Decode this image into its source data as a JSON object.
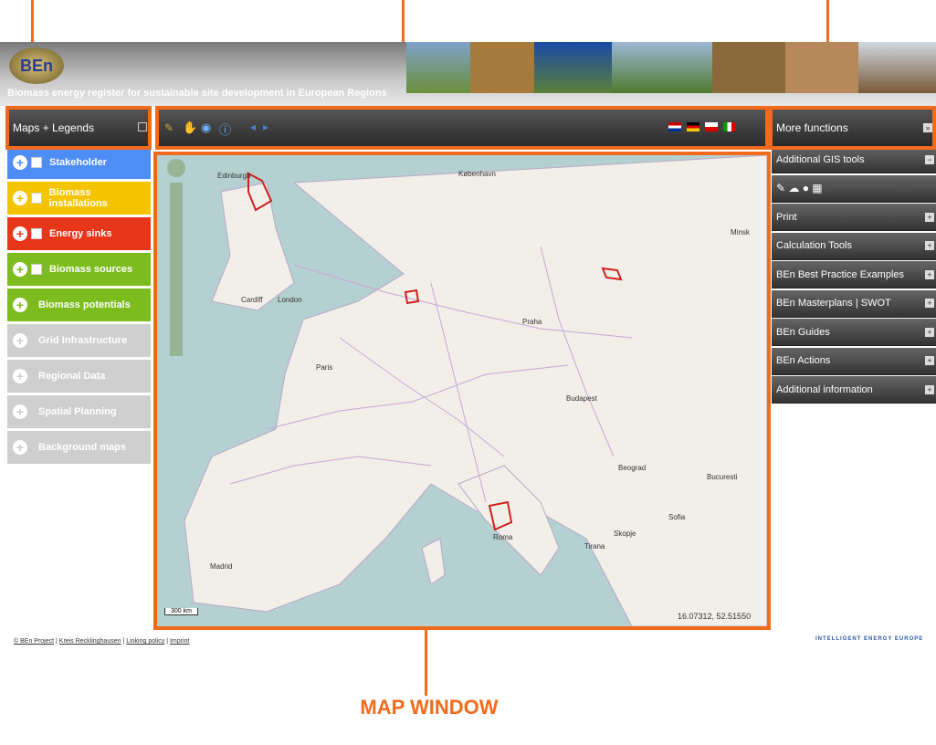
{
  "header": {
    "logo_text": "BEn",
    "tagline": "Biomass energy register for sustainable site development in European Regions"
  },
  "left_panel": {
    "title": "Maps + Legends",
    "layers": [
      {
        "label": "Stakeholder",
        "color": "#4d8df5",
        "checkbox": true,
        "active": true
      },
      {
        "label": "Biomass installations",
        "color": "#f5c400",
        "checkbox": true,
        "active": true
      },
      {
        "label": "Energy sinks",
        "color": "#e8361b",
        "checkbox": true,
        "active": true
      },
      {
        "label": "Biomass sources",
        "color": "#7cbc1e",
        "checkbox": true,
        "active": true
      },
      {
        "label": "Biomass potentials",
        "color": "#7cbc1e",
        "checkbox": false,
        "active": true
      },
      {
        "label": "Grid Infrastructure",
        "color": "#cfcfcf",
        "checkbox": false,
        "active": false
      },
      {
        "label": "Regional Data",
        "color": "#cfcfcf",
        "checkbox": false,
        "active": false
      },
      {
        "label": "Spatial Planning",
        "color": "#cfcfcf",
        "checkbox": false,
        "active": false
      },
      {
        "label": "Background maps",
        "color": "#cfcfcf",
        "checkbox": false,
        "active": false
      }
    ]
  },
  "right_panel": {
    "title": "More functions",
    "items": [
      {
        "label": "Additional GIS tools",
        "btn": "−"
      },
      {
        "label": "",
        "btn": ""
      },
      {
        "label": "Print",
        "btn": "+"
      },
      {
        "label": "Calculation Tools",
        "btn": "+"
      },
      {
        "label": "BEn Best Practice Examples",
        "btn": "+"
      },
      {
        "label": "BEn Masterplans | SWOT",
        "btn": "+"
      },
      {
        "label": "BEn Guides",
        "btn": "+"
      },
      {
        "label": "BEn Actions",
        "btn": "+"
      },
      {
        "label": "Additional information",
        "btn": "+"
      }
    ]
  },
  "map": {
    "scale": "300 km",
    "coords": "16.07312, 52.51550",
    "cities": [
      "Edinburgh",
      "København",
      "Cardiff",
      "London",
      "Paris",
      "Praha",
      "Budapest",
      "Beograd",
      "Bucuresti",
      "Sofia",
      "Tirana",
      "Skopje",
      "Madrid",
      "Roma",
      "Minsk"
    ]
  },
  "footer": {
    "copyright": "© BEn Project",
    "links": [
      "Kreis Recklinghausen",
      "Linking policy",
      "Imprint"
    ],
    "logo": "INTELLIGENT ENERGY EUROPE"
  },
  "annotation": {
    "map_window": "MAP WINDOW"
  }
}
